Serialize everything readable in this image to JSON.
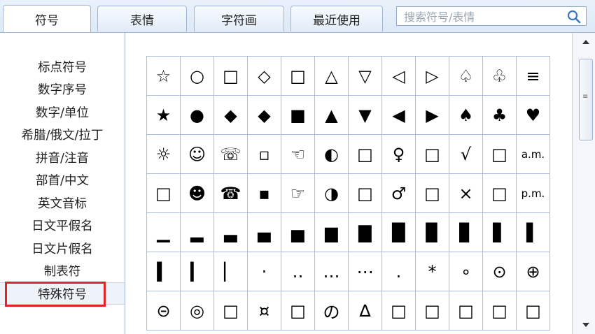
{
  "tabs": [
    {
      "label": "符号",
      "active": true
    },
    {
      "label": "表情",
      "active": false
    },
    {
      "label": "字符画",
      "active": false
    },
    {
      "label": "最近使用",
      "active": false
    }
  ],
  "search": {
    "placeholder": "搜索符号/表情",
    "icon": "search-icon"
  },
  "sidebar": {
    "items": [
      "标点符号",
      "数字序号",
      "数字/单位",
      "希腊/俄文/拉丁",
      "拼音/注音",
      "部首/中文",
      "英文音标",
      "日文平假名",
      "日文片假名",
      "制表符",
      "特殊符号"
    ],
    "selected_index": 10,
    "highlight_color": "#e0242a"
  },
  "grid": {
    "rows": [
      [
        "☆",
        "○",
        "□",
        "◇",
        "□",
        "△",
        "▽",
        "◁",
        "▷",
        "♤",
        "♧",
        "≡"
      ],
      [
        "★",
        "●",
        "◆",
        "◆",
        "■",
        "▲",
        "▼",
        "◀",
        "▶",
        "♠",
        "♣",
        "♥"
      ],
      [
        "☼",
        "☺",
        "☏",
        "▫",
        "☜",
        "◐",
        "□",
        "♀",
        "□",
        "√",
        "□",
        "a.m."
      ],
      [
        "□",
        "☻",
        "☎",
        "▪",
        "☞",
        "◑",
        "□",
        "♂",
        "□",
        "×",
        "□",
        "p.m."
      ],
      [
        "▁",
        "▂",
        "▃",
        "▄",
        "▅",
        "▆",
        "▇",
        "█",
        "▉",
        "▊",
        "▋",
        "▌"
      ],
      [
        "▍",
        "▎",
        "▏",
        "·",
        "‥",
        "…",
        "⋯",
        ".",
        "*",
        "∘",
        "⊙",
        "⊕"
      ],
      [
        "⊝",
        "◎",
        "□",
        "¤",
        "□",
        "の",
        "∆",
        "□",
        "□",
        "□",
        "□",
        "□"
      ]
    ]
  }
}
